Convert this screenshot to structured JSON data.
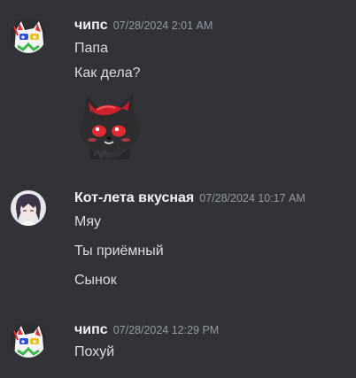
{
  "messages": [
    {
      "author": "чипс",
      "timestamp": "07/28/2024 2:01 AM",
      "lines": [
        "Папа",
        "Как дела?"
      ],
      "sticker": "wolf-pup-sticker"
    },
    {
      "author": "Кот-лета вкусная",
      "timestamp": "07/28/2024 10:17 AM",
      "lines": [
        "Мяу",
        "Ты приёмный",
        "Сынок"
      ]
    },
    {
      "author": "чипс",
      "timestamp": "07/28/2024 12:29 PM",
      "lines": [
        "Похуй"
      ]
    }
  ],
  "colors": {
    "background": "#313338",
    "author": "#f2f3f5",
    "text": "#dbdee1",
    "timestamp": "#949ba4"
  }
}
